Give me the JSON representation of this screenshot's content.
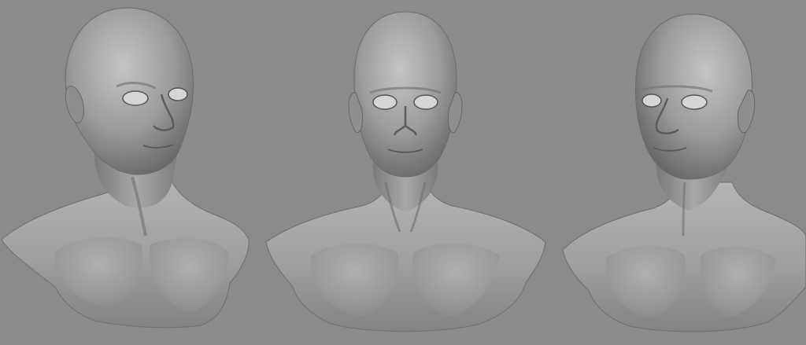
{
  "scene": {
    "background_color": "#8b8b8b",
    "clay_color": "#9a9a9a",
    "clay_highlight": "#c9c9c9",
    "clay_shadow": "#5e5e5e",
    "busts": [
      {
        "label": "bust-three-quarter-right",
        "view": "three-quarter-right"
      },
      {
        "label": "bust-front",
        "view": "front"
      },
      {
        "label": "bust-three-quarter-left",
        "view": "three-quarter-left"
      }
    ]
  }
}
